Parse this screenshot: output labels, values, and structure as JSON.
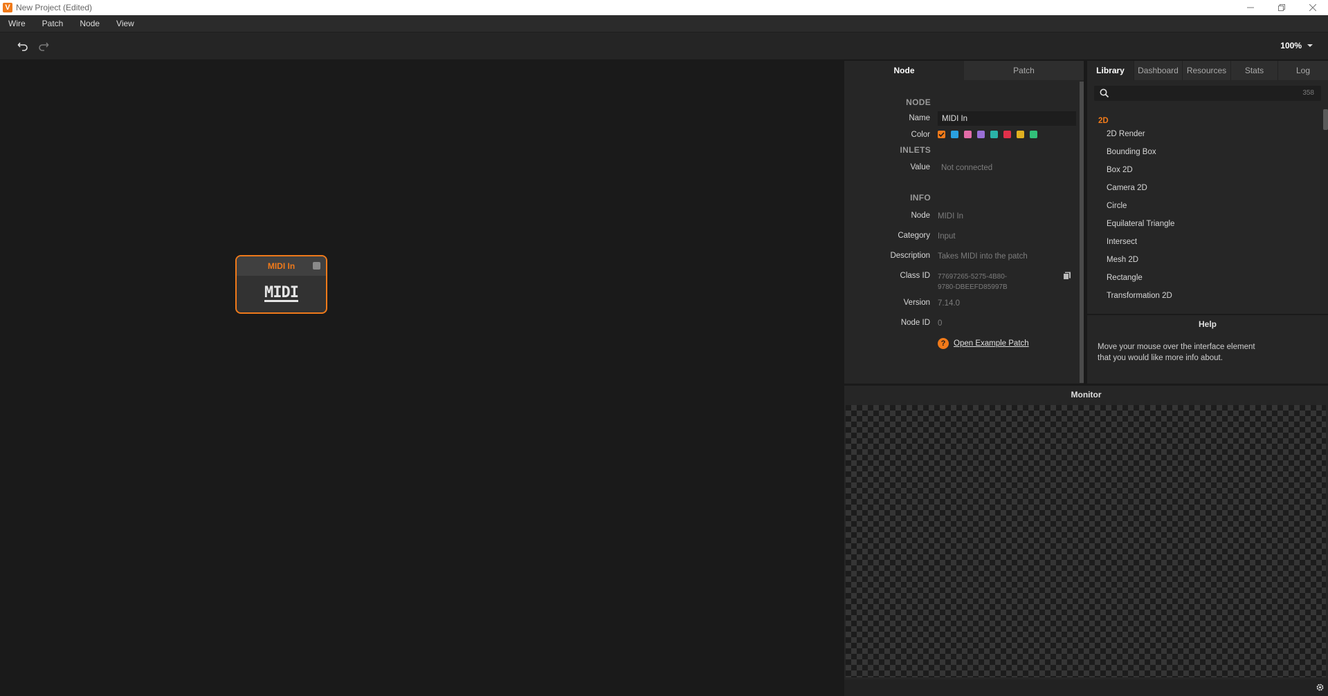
{
  "window": {
    "title": "New Project (Edited)",
    "logo": "V",
    "controls": [
      "minimize-icon",
      "restore-icon",
      "close-icon"
    ]
  },
  "menu": {
    "items": [
      "Wire",
      "Patch",
      "Node",
      "View"
    ]
  },
  "toolbar": {
    "undo_icon": "undo-icon",
    "redo_icon": "redo-icon",
    "zoom": "100%"
  },
  "canvas": {
    "node": {
      "title": "MIDI In",
      "icon": "MIDI"
    }
  },
  "inspector": {
    "tabs": [
      "Node",
      "Patch"
    ],
    "active_tab": "Node",
    "sections": {
      "node": "NODE",
      "inlets": "INLETS",
      "info": "INFO"
    },
    "name_label": "Name",
    "name_value": "MIDI In",
    "color_label": "Color",
    "colors": [
      "#f07a1a",
      "#2aa0e0",
      "#e26ca8",
      "#9a6fd6",
      "#2ab3a8",
      "#e0304a",
      "#e0b020",
      "#32c07a"
    ],
    "inlet_label": "Value",
    "inlet_value": "Not connected",
    "info": {
      "node_label": "Node",
      "node_value": "MIDI In",
      "category_label": "Category",
      "category_value": "Input",
      "description_label": "Description",
      "description_value": "Takes MIDI into the patch",
      "class_id_label": "Class ID",
      "class_id_line1": "77697265-5275-4B80-",
      "class_id_line2": "9780-DBEEFD85997B",
      "version_label": "Version",
      "version_value": "7.14.0",
      "node_id_label": "Node ID",
      "node_id_value": "0"
    },
    "example_icon": "?",
    "example_link": "Open Example Patch"
  },
  "library": {
    "tabs": [
      "Library",
      "Dashboard",
      "Resources",
      "Stats",
      "Log"
    ],
    "active_tab": "Library",
    "search_count": "358",
    "category": "2D",
    "items": [
      "2D Render",
      "Bounding Box",
      "Box 2D",
      "Camera 2D",
      "Circle",
      "Equilateral Triangle",
      "Intersect",
      "Mesh 2D",
      "Rectangle",
      "Transformation 2D"
    ]
  },
  "help": {
    "title": "Help",
    "text": "Move your mouse over the interface element that you would like more info about."
  },
  "monitor": {
    "title": "Monitor"
  },
  "colors": {
    "accent": "#f07a1a",
    "background": "#1a1a1a",
    "panel": "#262626"
  }
}
